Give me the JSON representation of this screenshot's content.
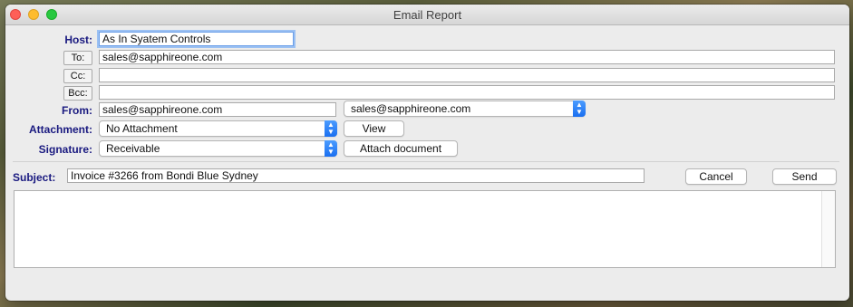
{
  "window": {
    "title": "Email Report"
  },
  "form": {
    "host_label": "Host:",
    "host_value": "As In Syatem Controls",
    "to_button": "To:",
    "to_value": "sales@sapphireone.com",
    "cc_button": "Cc:",
    "cc_value": "",
    "bcc_button": "Bcc:",
    "bcc_value": "",
    "from_label": "From:",
    "from_value": "sales@sapphireone.com",
    "from_select": "sales@sapphireone.com",
    "attachment_label": "Attachment:",
    "attachment_select": "No Attachment",
    "view_button": "View",
    "signature_label": "Signature:",
    "signature_select": "Receivable",
    "attach_document_button": "Attach document",
    "subject_label": "Subject:",
    "subject_value": "Invoice #3266 from Bondi Blue Sydney",
    "message_body": ""
  },
  "actions": {
    "cancel_button": "Cancel",
    "send_button": "Send"
  },
  "icons": {
    "popup_arrow": "chevron-up-down-icon"
  },
  "colors": {
    "label_color": "#1a1a80",
    "accent": "#1a6ff0",
    "close_light": "#fe5f57",
    "minimize_light": "#febc2e",
    "zoom_light": "#28c840"
  }
}
